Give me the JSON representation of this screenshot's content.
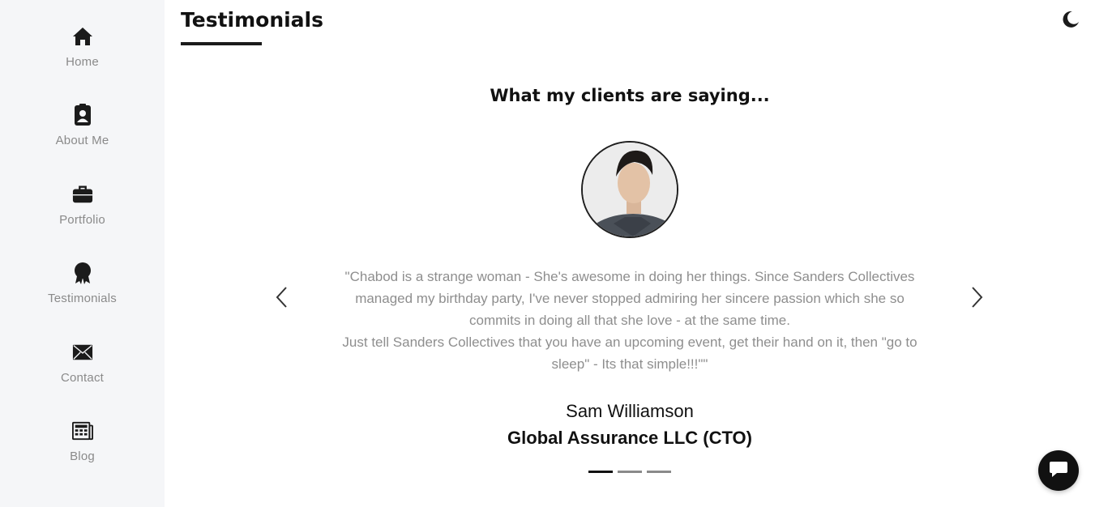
{
  "sidebar": {
    "items": [
      {
        "label": "Home",
        "icon": "home-icon"
      },
      {
        "label": "About Me",
        "icon": "id-badge-icon"
      },
      {
        "label": "Portfolio",
        "icon": "briefcase-icon"
      },
      {
        "label": "Testimonials",
        "icon": "award-icon"
      },
      {
        "label": "Contact",
        "icon": "envelope-icon"
      },
      {
        "label": "Blog",
        "icon": "newspaper-icon"
      }
    ]
  },
  "header": {
    "title": "Testimonials",
    "theme_toggle_icon": "moon-icon"
  },
  "testimonials": {
    "heading": "What my clients are saying...",
    "quote_line1": "\"Chabod is a strange woman - She's awesome in doing her things. Since Sanders Collectives managed my birthday party, I've never stopped admiring her sincere passion which she so commits in doing all that she love - at the same time.",
    "quote_line2": "Just tell Sanders Collectives that you have an upcoming event, get their hand on it, then \"go to sleep\" - Its that simple!!!\"\"",
    "author": "Sam Williamson",
    "company": "Global Assurance LLC (CTO)",
    "prev_icon": "chevron-left-icon",
    "next_icon": "chevron-right-icon",
    "slide_count": 3,
    "active_slide": 1
  },
  "chat": {
    "icon": "chat-bubble-icon"
  },
  "colors": {
    "sidebar_bg": "#f5f6f8",
    "text_dark": "#111111",
    "text_muted": "#8e8e8e",
    "accent": "#1b1b1b"
  }
}
